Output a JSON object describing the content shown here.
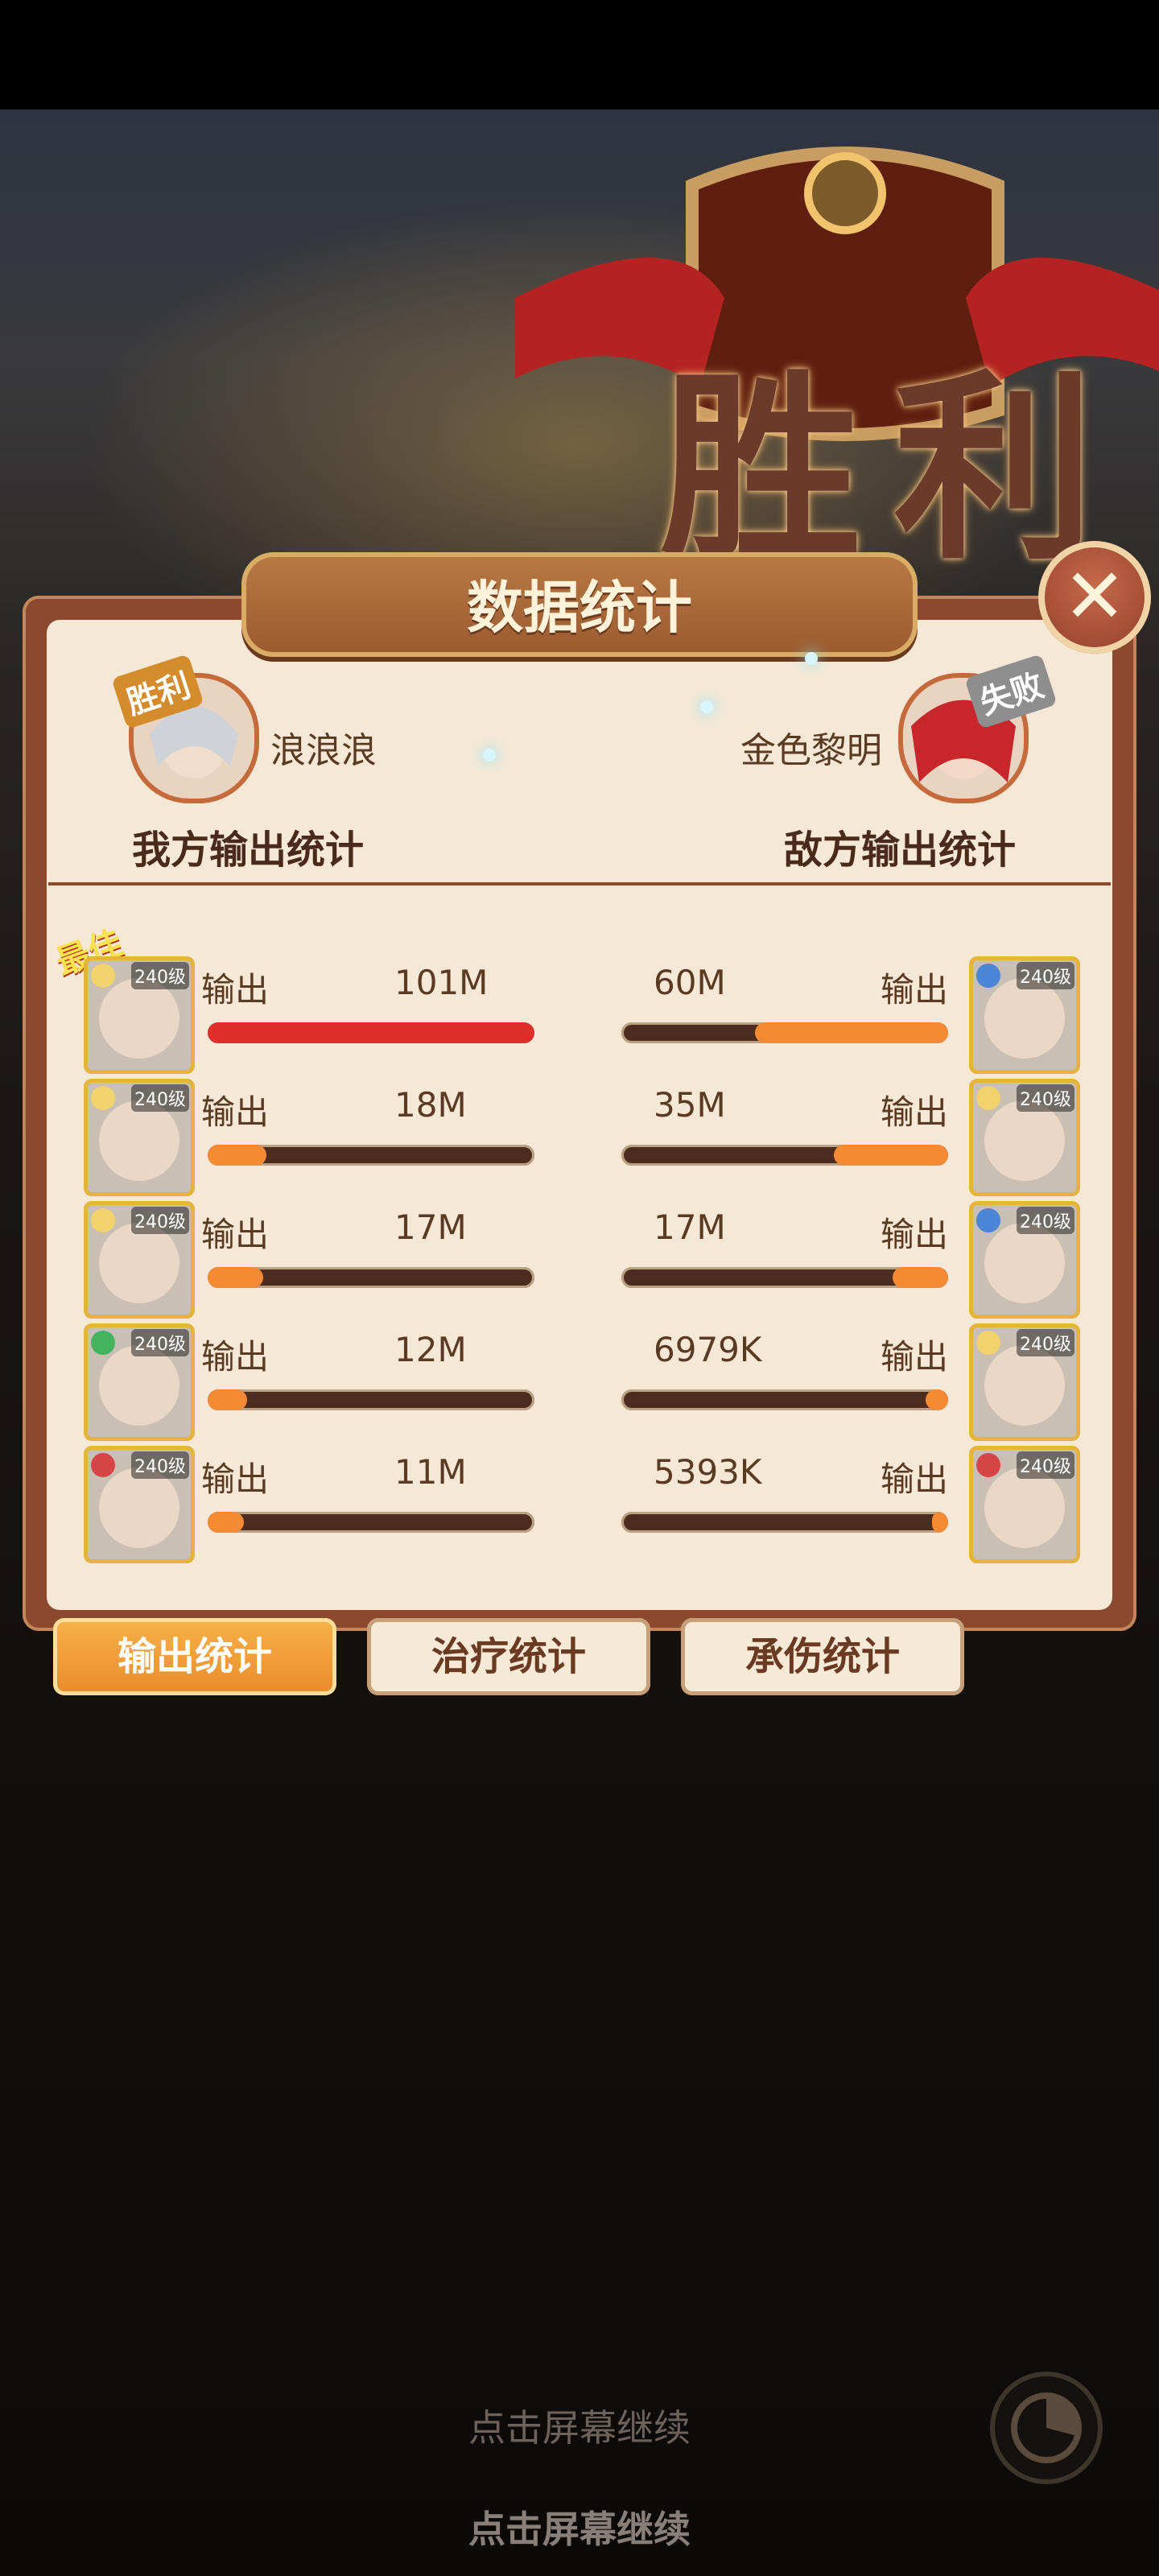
{
  "header": {
    "victory_text": "胜利",
    "title": "数据统计"
  },
  "players": {
    "left": {
      "name": "浪浪浪",
      "badge": "胜利",
      "section": "我方输出统计"
    },
    "right": {
      "name": "金色黎明",
      "badge": "失败",
      "section": "敌方输出统计"
    }
  },
  "best_tag": "最佳",
  "rows": [
    {
      "left": {
        "label": "输出",
        "value": "101M",
        "level": "240级",
        "fraction": 1.0
      },
      "right": {
        "label": "输出",
        "value": "60M",
        "level": "240级",
        "fraction": 0.59
      }
    },
    {
      "left": {
        "label": "输出",
        "value": "18M",
        "level": "240级",
        "fraction": 0.18
      },
      "right": {
        "label": "输出",
        "value": "35M",
        "level": "240级",
        "fraction": 0.35
      }
    },
    {
      "left": {
        "label": "输出",
        "value": "17M",
        "level": "240级",
        "fraction": 0.17
      },
      "right": {
        "label": "输出",
        "value": "17M",
        "level": "240级",
        "fraction": 0.17
      }
    },
    {
      "left": {
        "label": "输出",
        "value": "12M",
        "level": "240级",
        "fraction": 0.12
      },
      "right": {
        "label": "输出",
        "value": "6979K",
        "level": "240级",
        "fraction": 0.07
      }
    },
    {
      "left": {
        "label": "输出",
        "value": "11M",
        "level": "240级",
        "fraction": 0.11
      },
      "right": {
        "label": "输出",
        "value": "5393K",
        "level": "240级",
        "fraction": 0.05
      }
    }
  ],
  "tabs": [
    "输出统计",
    "治疗统计",
    "承伤统计"
  ],
  "footer": {
    "continue_1": "点击屏幕继续",
    "continue_2": "点击屏幕继续"
  },
  "colors": {
    "bar_left_top": "#e02f2a",
    "bar_other": "#f48a34"
  }
}
